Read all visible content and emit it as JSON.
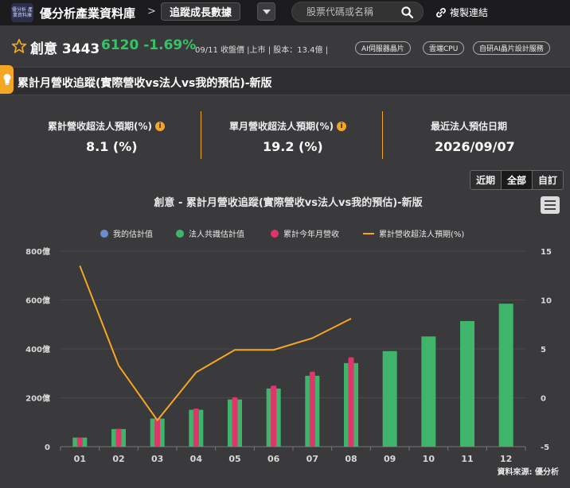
{
  "topbar": {
    "logo_text": "優分析\n產業資料庫",
    "site_title": "優分析產業資料庫",
    "separator": ">",
    "section": "追蹤成長數據",
    "search_placeholder": "股票代碼或名稱",
    "copy_link": "複製連結"
  },
  "stock": {
    "name": "創意 3443",
    "price": "6120 -1.69%",
    "close_meta": "09/11 收盤價 |上市 | 股本：13.4億 |",
    "tags": [
      "AI伺服器晶片",
      "雲端CPU",
      "自研AI晶片設計服務"
    ]
  },
  "panel": {
    "title": "累計月營收追蹤(實際營收vs法人vs我的預估)-新版"
  },
  "stats": [
    {
      "label": "累計營收超法人預期(%)",
      "value": "8.1 (%)",
      "info": true
    },
    {
      "label": "單月營收超法人預期(%)",
      "value": "19.2 (%)",
      "info": true
    },
    {
      "label": "最近法人預估日期",
      "value": "2026/09/07",
      "info": false
    }
  ],
  "periods": {
    "options": [
      "近期",
      "全部",
      "自訂"
    ],
    "selected": "全部"
  },
  "colors": {
    "accent": "#f5a623",
    "my_estimate": "#6b8ccf",
    "consensus": "#3fb56b",
    "actual": "#e0356a",
    "beat_line": "#f5a623",
    "up_green": "#35c465"
  },
  "chart_data": {
    "type": "bar",
    "title": "創意 - 累計月營收追蹤(實際營收vs法人vs我的預估)-新版",
    "categories": [
      "01",
      "02",
      "03",
      "04",
      "05",
      "06",
      "07",
      "08",
      "09",
      "10",
      "11",
      "12"
    ],
    "y_left": {
      "ticks": [
        "0",
        "200億",
        "400億",
        "600億",
        "800億"
      ],
      "ylim": [
        0,
        800
      ]
    },
    "y_right": {
      "ticks": [
        "-5",
        "0",
        "5",
        "10",
        "15"
      ],
      "ylim": [
        -5,
        15
      ]
    },
    "legend": [
      "我的估計值",
      "法人共識估計值",
      "累計今年月營收",
      "累計營收超法人預期(%)"
    ],
    "legend_position": "top",
    "series": [
      {
        "name": "法人共識估計值",
        "kind": "bar",
        "axis": "left",
        "values": [
          37,
          72,
          115,
          151,
          193,
          238,
          290,
          342,
          391,
          451,
          514,
          585
        ]
      },
      {
        "name": "累計今年月營收",
        "kind": "bar",
        "axis": "left",
        "values": [
          38,
          73,
          113,
          156,
          202,
          250,
          307,
          366,
          null,
          null,
          null,
          null
        ]
      },
      {
        "name": "累計營收超法人預期(%)",
        "kind": "line",
        "axis": "right",
        "values": [
          13.5,
          3.3,
          -2.3,
          2.6,
          4.9,
          4.9,
          6.1,
          8.1,
          null,
          null,
          null,
          null
        ]
      }
    ],
    "source": "資料來源: 優分析"
  }
}
